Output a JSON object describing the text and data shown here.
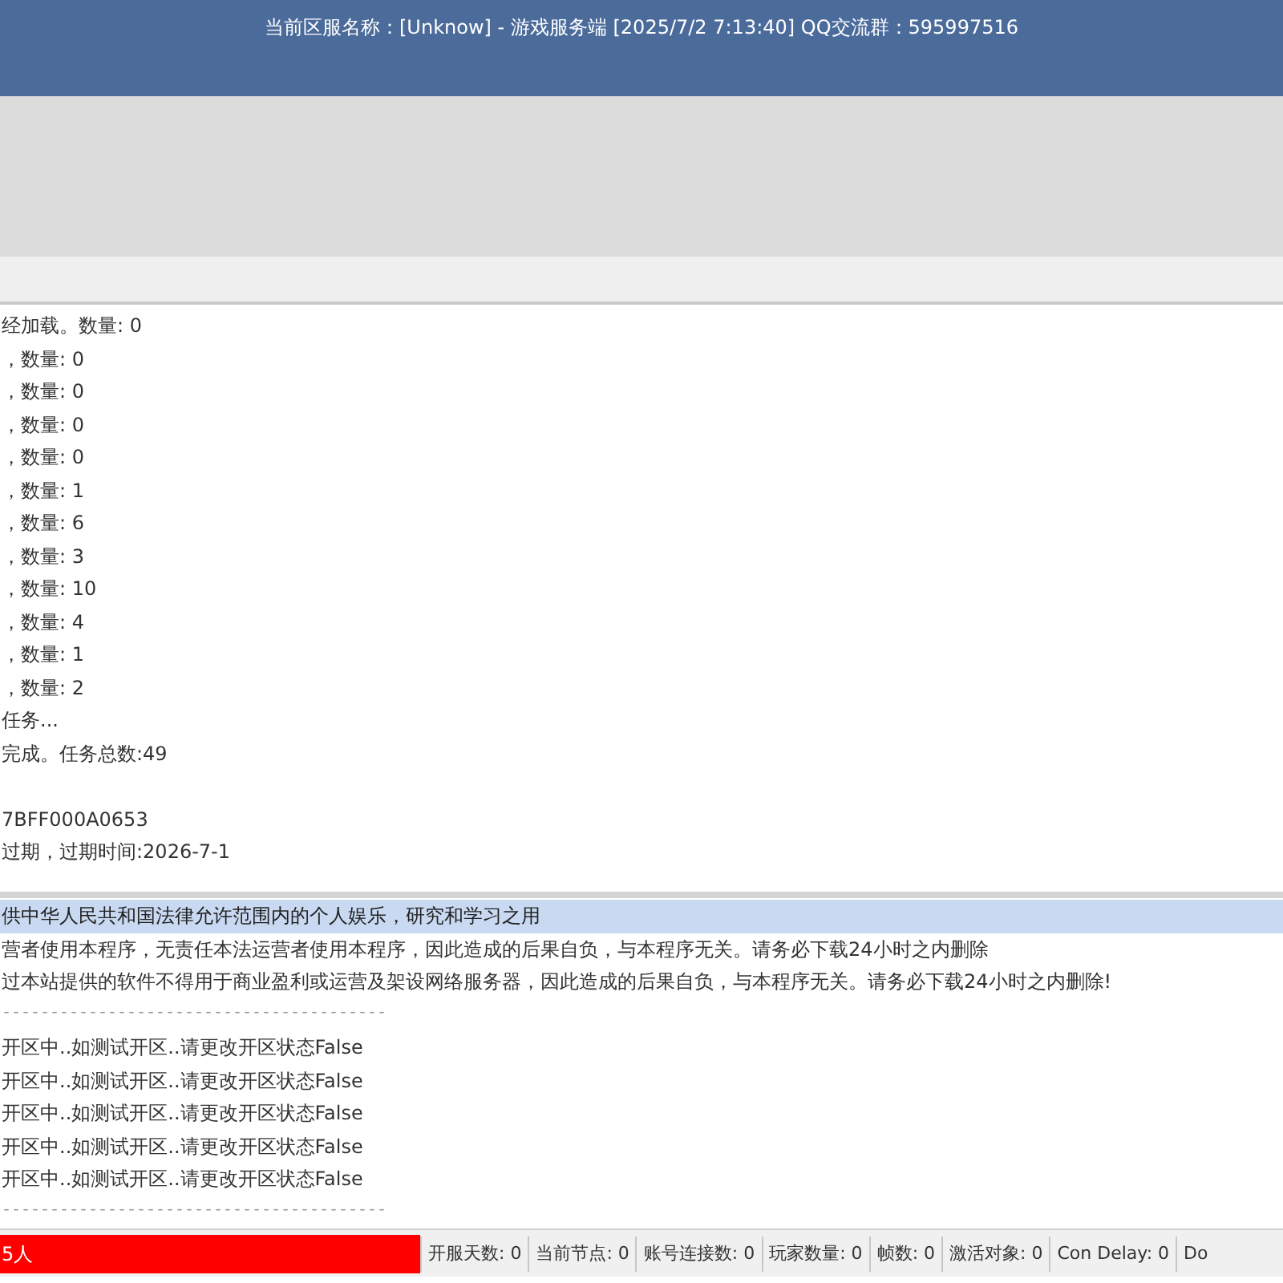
{
  "window": {
    "title": "当前区服名称：[Unknow] - 游戏服务端 [2025/7/2 7:13:40] QQ交流群：595997516"
  },
  "log": {
    "groups": [
      [
        "经加载。数量: 0",
        "，数量: 0",
        "，数量: 0",
        "，数量: 0",
        "，数量: 0",
        "，数量: 1",
        "，数量: 6",
        "，数量: 3",
        "，数量: 10",
        "，数量: 4",
        "，数量: 1",
        "，数量: 2",
        "任务...",
        "完成。任务总数:49"
      ],
      [
        "7BFF000A0653",
        "过期，过期时间:2026-7-1"
      ]
    ]
  },
  "messages": [
    {
      "kind": "text",
      "text": "供中华人民共和国法律允许范围内的个人娱乐，研究和学习之用",
      "selected": true
    },
    {
      "kind": "text",
      "text": "营者使用本程序，无责任本法运营者使用本程序，因此造成的后果自负，与本程序无关。请务必下载24小时之内删除",
      "selected": false
    },
    {
      "kind": "text",
      "text": "过本站提供的软件不得用于商业盈利或运营及架设网络服务器，因此造成的后果自负，与本程序无关。请务必下载24小时之内删除!",
      "selected": false
    },
    {
      "kind": "rule",
      "text": "----------------------------------------",
      "selected": false
    },
    {
      "kind": "text",
      "text": "开区中..如测试开区..请更改开区状态False",
      "selected": false
    },
    {
      "kind": "text",
      "text": "开区中..如测试开区..请更改开区状态False",
      "selected": false
    },
    {
      "kind": "text",
      "text": "开区中..如测试开区..请更改开区状态False",
      "selected": false
    },
    {
      "kind": "text",
      "text": "开区中..如测试开区..请更改开区状态False",
      "selected": false
    },
    {
      "kind": "text",
      "text": "开区中..如测试开区..请更改开区状态False",
      "selected": false
    },
    {
      "kind": "rule",
      "text": "----------------------------------------",
      "selected": false
    }
  ],
  "status_bar": {
    "message": "5人",
    "fields": [
      "开服天数: 0",
      "当前节点: 0",
      "账号连接数: 0",
      "玩家数量: 0",
      "帧数: 0",
      "激活对象: 0",
      "Con Delay: 0",
      "Do"
    ]
  }
}
